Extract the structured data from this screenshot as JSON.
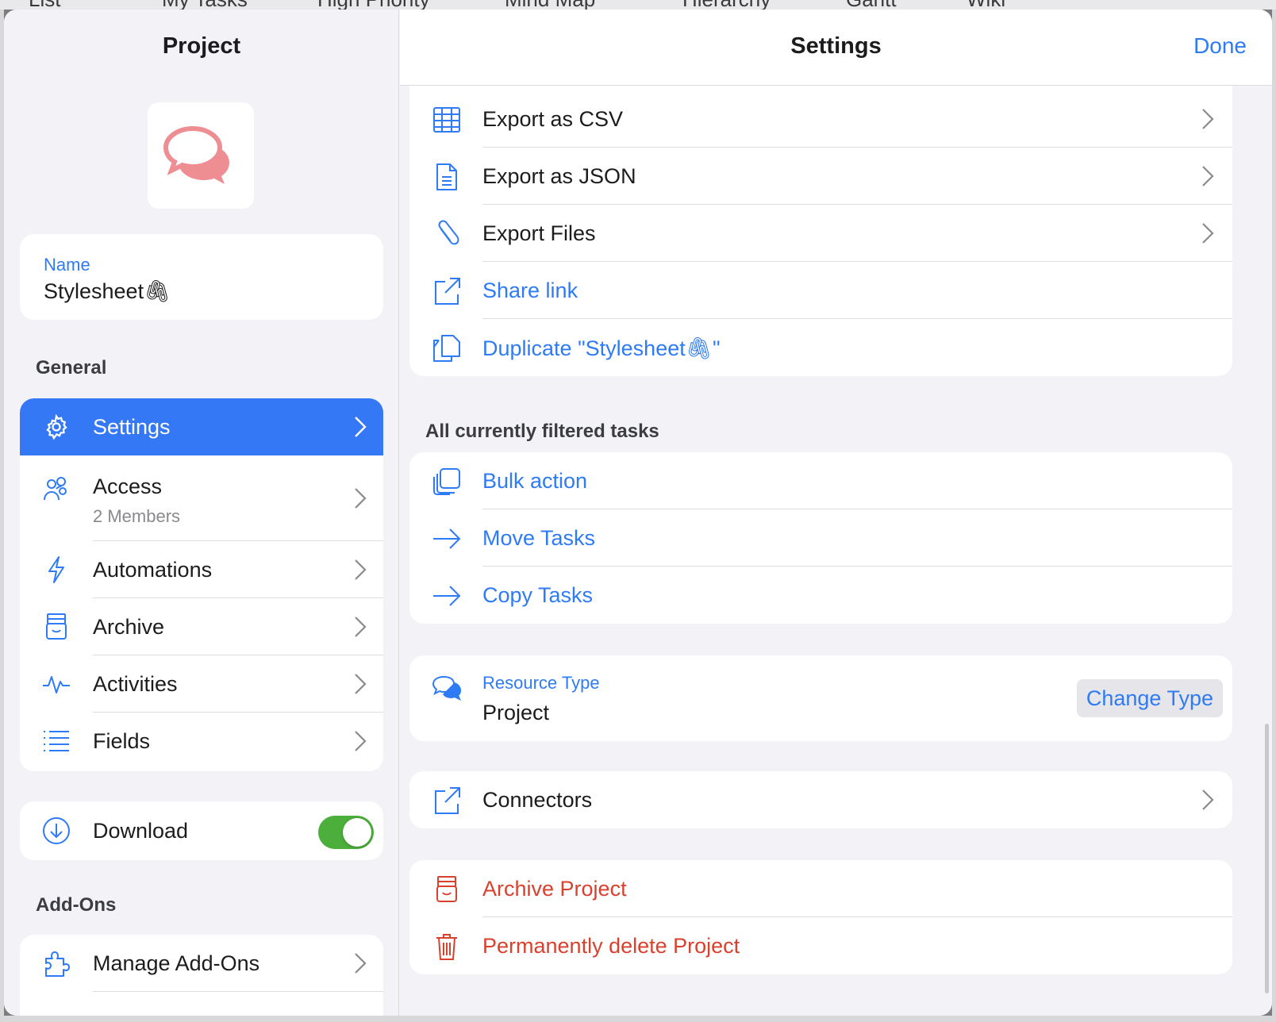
{
  "background_tabs": [
    "List",
    "My Tasks",
    "High Priority",
    "Mind Map",
    "Hierarchy",
    "Gantt",
    "Wiki"
  ],
  "left_pane": {
    "title": "Project",
    "name_field": {
      "label": "Name",
      "value": "Stylesheet🖇"
    },
    "general_header": "General",
    "nav_items": [
      {
        "label": "Settings",
        "icon": "gear-icon",
        "active": true
      },
      {
        "label": "Access",
        "sub": "2 Members",
        "icon": "people-icon"
      },
      {
        "label": "Automations",
        "icon": "lightning-icon"
      },
      {
        "label": "Archive",
        "icon": "archive-box-icon"
      },
      {
        "label": "Activities",
        "icon": "pulse-icon"
      },
      {
        "label": "Fields",
        "icon": "list-icon"
      }
    ],
    "download": {
      "label": "Download",
      "enabled": true
    },
    "addons_header": "Add-Ons",
    "addons_items": [
      {
        "label": "Manage Add-Ons",
        "icon": "puzzle-icon"
      }
    ]
  },
  "right_pane": {
    "title": "Settings",
    "done_label": "Done",
    "export_rows": [
      {
        "label": "Export as CSV",
        "icon": "table-icon",
        "style": "black",
        "chevron": true
      },
      {
        "label": "Export as JSON",
        "icon": "document-icon",
        "style": "black",
        "chevron": true
      },
      {
        "label": "Export Files",
        "icon": "paperclip-icon",
        "style": "black",
        "chevron": true
      },
      {
        "label": "Share link",
        "icon": "external-link-icon",
        "style": "blue",
        "chevron": false
      },
      {
        "label": "Duplicate \"Stylesheet🖇\"",
        "icon": "duplicate-icon",
        "style": "blue",
        "chevron": false
      }
    ],
    "filtered_header": "All currently filtered tasks",
    "filtered_rows": [
      {
        "label": "Bulk action",
        "icon": "stack-icon"
      },
      {
        "label": "Move Tasks",
        "icon": "arrow-right-icon"
      },
      {
        "label": "Copy Tasks",
        "icon": "arrow-right-icon"
      }
    ],
    "resource_type": {
      "label": "Resource Type",
      "value": "Project",
      "button": "Change Type"
    },
    "connectors_label": "Connectors",
    "danger_rows": [
      {
        "label": "Archive Project",
        "icon": "archive-box-icon"
      },
      {
        "label": "Permanently delete Project",
        "icon": "trash-icon"
      }
    ],
    "colors": {
      "accent": "#2f7bf5",
      "danger": "#d9412e",
      "toggle_on": "#4cae3b",
      "project_icon": "#ee8e93"
    }
  }
}
